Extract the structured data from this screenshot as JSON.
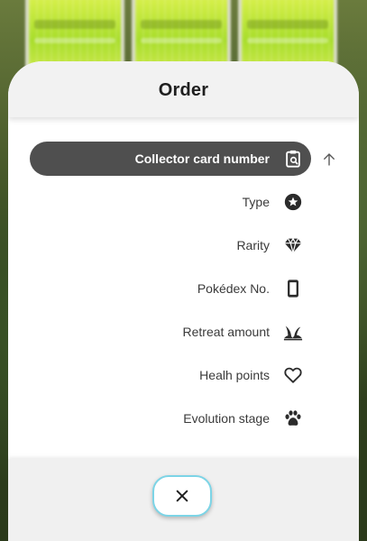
{
  "sheet": {
    "title": "Order"
  },
  "sort_options": [
    {
      "label": "Collector card number",
      "icon": "clipboard-search-icon",
      "selected": true
    },
    {
      "label": "Type",
      "icon": "star-badge-icon",
      "selected": false
    },
    {
      "label": "Rarity",
      "icon": "diamond-icon",
      "selected": false
    },
    {
      "label": "Pokédex No.",
      "icon": "phone-icon",
      "selected": false
    },
    {
      "label": "Retreat amount",
      "icon": "grass-icon",
      "selected": false
    },
    {
      "label": "Healh points",
      "icon": "heart-icon",
      "selected": false
    },
    {
      "label": "Evolution stage",
      "icon": "paw-icon",
      "selected": false
    }
  ],
  "sort_direction_icon": "arrow-up-icon",
  "close_icon": "close-icon",
  "colors": {
    "selected_background": "#4f4f4f",
    "close_border": "#7cd4e6",
    "card_green": "#a8dd2a"
  }
}
